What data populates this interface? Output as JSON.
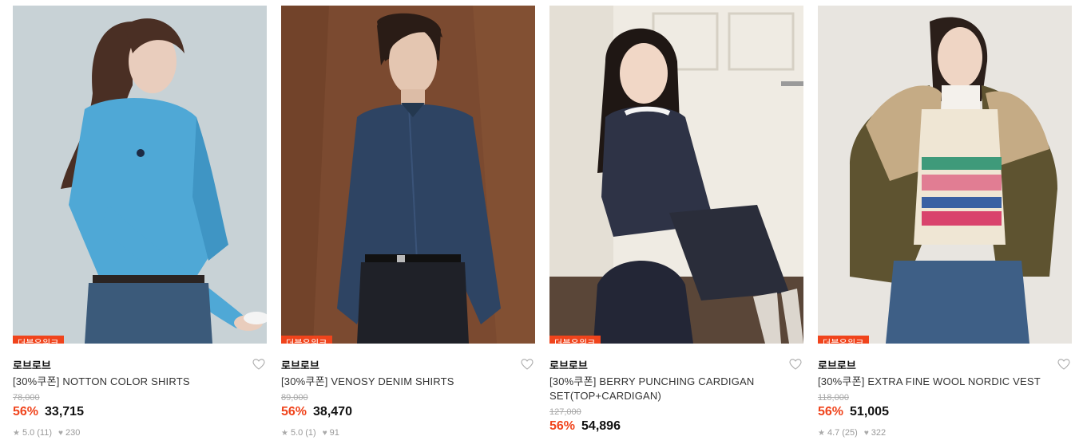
{
  "products": [
    {
      "badge": "더블유위크",
      "brand": "로브로브",
      "name": "[30%쿠폰] NOTTON COLOR SHIRTS",
      "original_price": "78,000",
      "discount": "56%",
      "price": "33,715",
      "rating": "5.0",
      "reviews": "(11)",
      "likes": "230",
      "colors": {
        "bg": "#c9d3d8",
        "garment": "#4fa8d6",
        "bottom": "#3b5a7a"
      }
    },
    {
      "badge": "더블유위크",
      "brand": "로브로브",
      "name": "[30%쿠폰] VENOSY DENIM SHIRTS",
      "original_price": "89,000",
      "discount": "56%",
      "price": "38,470",
      "rating": "5.0",
      "reviews": "(1)",
      "likes": "91",
      "colors": {
        "bg": "#7a4a30",
        "garment": "#2e4463",
        "bottom": "#1f2128"
      }
    },
    {
      "badge": "더블유위크",
      "brand": "로브로브",
      "name": "[30%쿠폰] BERRY PUNCHING CARDIGAN SET(TOP+CARDIGAN)",
      "original_price": "127,000",
      "discount": "56%",
      "price": "54,896",
      "rating": "",
      "reviews": "",
      "likes": "",
      "colors": {
        "bg": "#e6e1d8",
        "garment": "#2e3346",
        "bottom": "#2a2d3a"
      }
    },
    {
      "badge": "더블유위크",
      "brand": "로브로브",
      "name": "[30%쿠폰] EXTRA FINE WOOL NORDIC VEST",
      "original_price": "118,000",
      "discount": "56%",
      "price": "51,005",
      "rating": "4.7",
      "reviews": "(25)",
      "likes": "322",
      "colors": {
        "bg": "#e7e4df",
        "garment": "#6a5a32",
        "bottom": "#3e5f86"
      }
    }
  ],
  "icons": {
    "heart": "heart-outline-icon",
    "star": "star-icon",
    "like": "heart-filled-icon"
  }
}
